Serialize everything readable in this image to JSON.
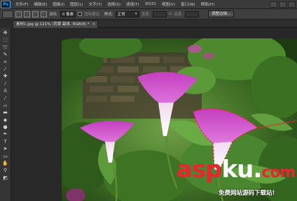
{
  "app": {
    "logo": "Ps"
  },
  "menu": [
    "文件(F)",
    "编辑(E)",
    "图像(I)",
    "图层(L)",
    "文字(Y)",
    "选择(S)",
    "滤镜(T)",
    "3D(D)",
    "视图(V)",
    "窗口(W)",
    "帮助(H)"
  ],
  "options": {
    "feather_label": "羽化:",
    "feather_value": "0 像素",
    "antialias_label": "消除锯齿",
    "style_label": "样式:",
    "style_value": "正常",
    "width_label": "宽度:",
    "height_label": "高度:",
    "refine_edge_label": "调整边缘..."
  },
  "document": {
    "tab_title": "素材1.jpg @ 121% (背景 副本, RGB/8) *",
    "close_symbol": "×"
  },
  "tools": [
    {
      "icon": "move-icon",
      "glyph": "✥"
    },
    {
      "icon": "marquee-icon",
      "glyph": "⬚"
    },
    {
      "icon": "lasso-icon",
      "glyph": "➰"
    },
    {
      "icon": "quick-select-icon",
      "glyph": "✎"
    },
    {
      "icon": "crop-icon",
      "glyph": "⌗"
    },
    {
      "icon": "eyedropper-icon",
      "glyph": "⁄"
    },
    {
      "icon": "healing-icon",
      "glyph": "✚"
    },
    {
      "icon": "brush-icon",
      "glyph": "⁄"
    },
    {
      "icon": "clone-stamp-icon",
      "glyph": "♙"
    },
    {
      "icon": "history-brush-icon",
      "glyph": "⁄"
    },
    {
      "icon": "eraser-icon",
      "glyph": "▱"
    },
    {
      "icon": "gradient-icon",
      "glyph": "▬"
    },
    {
      "icon": "blur-icon",
      "glyph": "◆"
    },
    {
      "icon": "dodge-icon",
      "glyph": "●"
    },
    {
      "icon": "pen-icon",
      "glyph": "✒"
    },
    {
      "icon": "type-icon",
      "glyph": "T"
    },
    {
      "icon": "path-select-icon",
      "glyph": "➤"
    },
    {
      "icon": "shape-icon",
      "glyph": "▭"
    },
    {
      "icon": "hand-icon",
      "glyph": "✋"
    },
    {
      "icon": "zoom-icon",
      "glyph": "⚲"
    },
    {
      "icon": "foreground-color-icon",
      "glyph": "◩"
    }
  ],
  "watermark": {
    "asp": "asp",
    "ku": "ku",
    "dot": ".",
    "com": "com",
    "subtitle": "免费网站源码下载站!"
  },
  "colors": {
    "accent": "#31a8ff",
    "watermark_red": "#e8262d",
    "flower": "#d957d0",
    "selection": "#e8262d"
  }
}
